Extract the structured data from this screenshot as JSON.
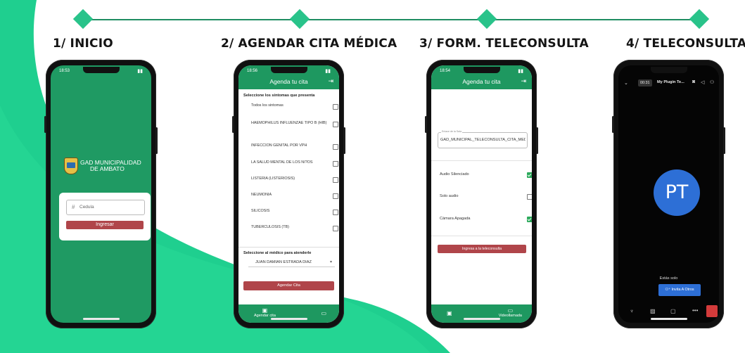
{
  "colors": {
    "brand_green": "#1e9860",
    "accent_red": "#b0454a",
    "zoom_blue": "#2d6fd6",
    "bg_mint": "#1fcf8f"
  },
  "steps": [
    {
      "title": "1/ INICIO"
    },
    {
      "title": "2/ AGENDAR CITA MÉDICA"
    },
    {
      "title": "3/ FORM. TELECONSULTA"
    },
    {
      "title": "4/ TELECONSULTA"
    }
  ],
  "phone1": {
    "time": "18:53",
    "logo_line1": "GAD MUNICIPALIDAD",
    "logo_line2": "DE AMBATO",
    "id_icon": "#",
    "id_placeholder": "Cedula",
    "login_button": "Ingresar"
  },
  "phone2": {
    "time": "18:56",
    "title": "Agenda tu cita",
    "exit_icon": "exit-icon",
    "symptoms_heading": "Seleccione los síntomas que presenta",
    "symptoms": [
      {
        "label": "Todos los sintomas"
      },
      {
        "label": "HAEMOPHILUS INFLUENZAE TIPO B (HIB)"
      },
      {
        "label": "INFECCION GENITAL POR VPH"
      },
      {
        "label": "LA SALUD MENTAL DE LOS NI?OS"
      },
      {
        "label": "LISTERIA (LISTERIOSIS)"
      },
      {
        "label": "NEUMONIA"
      },
      {
        "label": "SILICOSIS"
      },
      {
        "label": "TUBERCULOSIS (TB)"
      }
    ],
    "doctor_heading": "Seleccione al médico para atenderle",
    "doctor_selected": "JUAN DAMIAN ESTRADA DIAZ",
    "schedule_button": "Agendar Cita",
    "tabs": [
      {
        "label": "Agendar cita",
        "icon": "calendar-icon"
      },
      {
        "label": "",
        "icon": "video-icon"
      }
    ]
  },
  "phone3": {
    "time": "18:54",
    "title": "Agenda tu cita",
    "room_label": "Enlace de la Sala",
    "room_value": "GAD_MUNICIPAL_TELECONSULTA_CITA_MEDIC",
    "options": [
      {
        "label": "Audio Silenciado",
        "checked": true
      },
      {
        "label": "Solo audio",
        "checked": false
      },
      {
        "label": "Cámara Apagada",
        "checked": true
      }
    ],
    "join_button": "Ingresa a la teleconsulta",
    "tabs": [
      {
        "label": "",
        "icon": "calendar-icon"
      },
      {
        "label": "Videollamada",
        "icon": "video-icon"
      }
    ]
  },
  "phone4": {
    "timer": "00:31",
    "meeting_name": "My Plugin Te...",
    "avatar_initials": "PT",
    "alone_text": "Estás solo",
    "invite_button": "Invita A Otros",
    "toolbar_icons": [
      "microphone-icon",
      "camera-off-icon",
      "chat-icon",
      "more-icon"
    ],
    "leave_icon": "leave-call-icon"
  }
}
